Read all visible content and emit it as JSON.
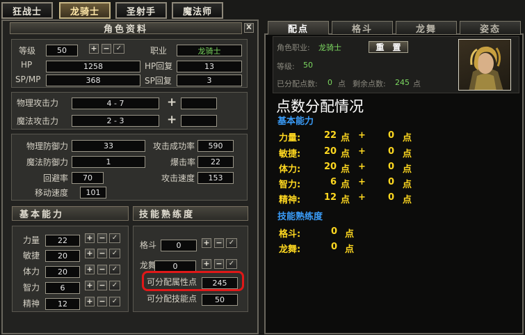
{
  "top_tabs": [
    "狂战士",
    "龙骑士",
    "圣射手",
    "魔法师"
  ],
  "left": {
    "title": "角色资料",
    "close": "X",
    "level_label": "等级",
    "level": "50",
    "class_label": "职业",
    "class_value": "龙骑士",
    "hp_label": "HP",
    "hp": "1258",
    "hp_regen_label": "HP回复",
    "hp_regen": "13",
    "sp_label": "SP/MP",
    "sp": "368",
    "sp_regen_label": "SP回复",
    "sp_regen": "3",
    "phys_atk_label": "物理攻击力",
    "phys_atk": "4 - 7",
    "mag_atk_label": "魔法攻击力",
    "mag_atk": "2 - 3",
    "phys_def_label": "物理防御力",
    "phys_def": "33",
    "hit_rate_label": "攻击成功率",
    "hit_rate": "590",
    "mag_def_label": "魔法防御力",
    "mag_def": "1",
    "crit_label": "爆击率",
    "crit": "22",
    "evade_label": "回避率",
    "evade": "70",
    "atk_speed_label": "攻击速度",
    "atk_speed": "153",
    "move_speed_label": "移动速度",
    "move_speed": "101",
    "basic_header": "基本能力",
    "skill_header": "技能熟练度",
    "stats": [
      {
        "label": "力量",
        "value": "22"
      },
      {
        "label": "敏捷",
        "value": "20"
      },
      {
        "label": "体力",
        "value": "20"
      },
      {
        "label": "智力",
        "value": "6"
      },
      {
        "label": "精神",
        "value": "12"
      }
    ],
    "skills": [
      {
        "label": "格斗",
        "value": "0"
      },
      {
        "label": "龙舞",
        "value": "0"
      }
    ],
    "free_attr_label": "可分配属性点",
    "free_attr": "245",
    "free_skill_label": "可分配技能点",
    "free_skill": "50"
  },
  "right": {
    "tabs": [
      "配点",
      "格斗",
      "龙舞",
      "姿态"
    ],
    "class_label": "角色职业:",
    "class_value": "龙骑士",
    "reset_button": "重　置",
    "level_label": "等级:",
    "level": "50",
    "allocated_label": "已分配点数:",
    "allocated": "0",
    "point_unit": "点",
    "remaining_label": "剩余点数:",
    "remaining": "245",
    "big_title": "点数分配情况",
    "basic_title": "基本能力",
    "plus_sign": "+",
    "basic_rows": [
      {
        "label": "力量:",
        "base": "22",
        "added": "0"
      },
      {
        "label": "敏捷:",
        "base": "20",
        "added": "0"
      },
      {
        "label": "体力:",
        "base": "20",
        "added": "0"
      },
      {
        "label": "智力:",
        "base": "6",
        "added": "0"
      },
      {
        "label": "精神:",
        "base": "12",
        "added": "0"
      }
    ],
    "skill_title": "技能熟练度",
    "skill_rows": [
      {
        "label": "格斗:",
        "value": "0"
      },
      {
        "label": "龙舞:",
        "value": "0"
      }
    ]
  },
  "buttons": {
    "plus": "+",
    "minus": "−",
    "check": "✓"
  },
  "highlight_color": "#e01818"
}
